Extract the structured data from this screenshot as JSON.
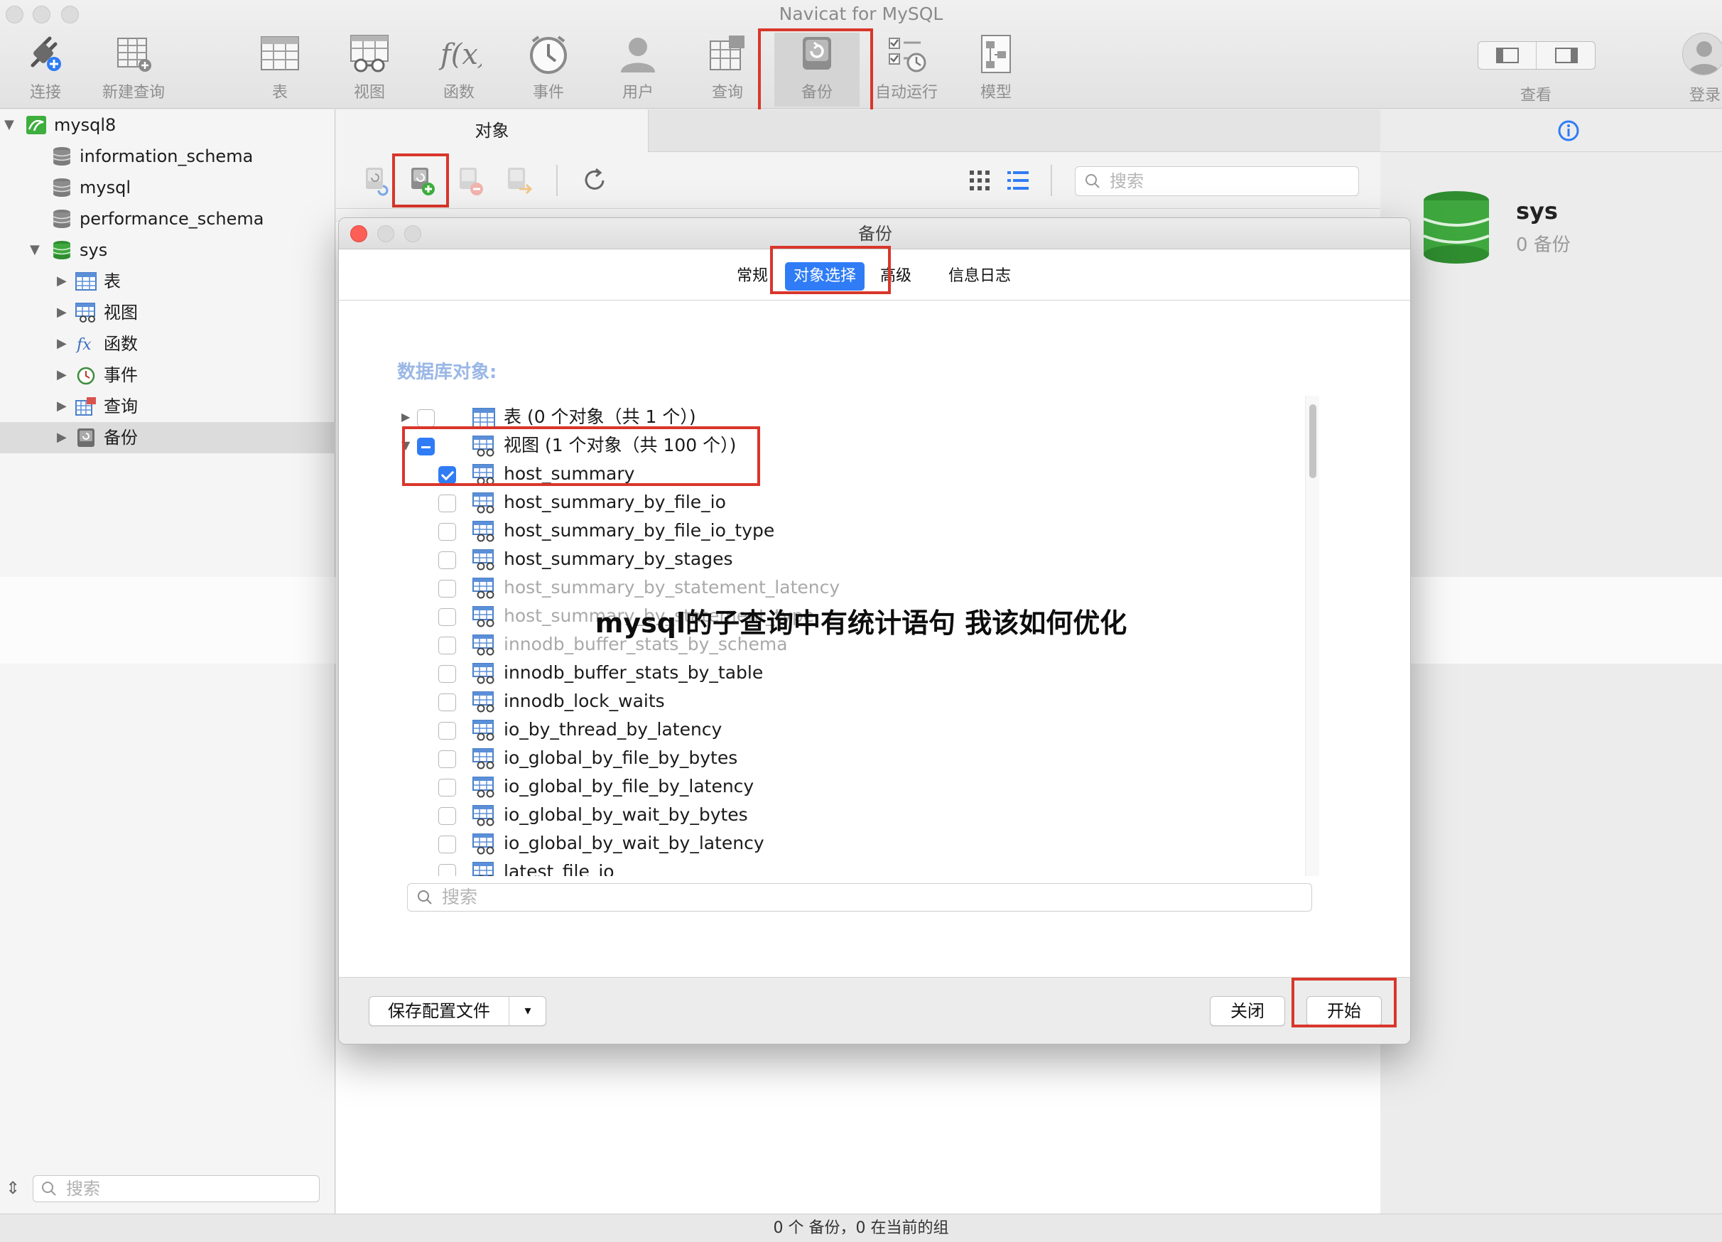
{
  "window": {
    "title": "Navicat for MySQL"
  },
  "toolbar": {
    "items": [
      {
        "label": "连接",
        "icon": "plug-icon"
      },
      {
        "label": "新建查询",
        "icon": "new-query-icon"
      },
      {
        "label": "表",
        "icon": "table-icon"
      },
      {
        "label": "视图",
        "icon": "view-icon"
      },
      {
        "label": "函数",
        "icon": "function-icon"
      },
      {
        "label": "事件",
        "icon": "clock-icon"
      },
      {
        "label": "用户",
        "icon": "user-icon"
      },
      {
        "label": "查询",
        "icon": "query-icon"
      },
      {
        "label": "备份",
        "icon": "backup-icon"
      },
      {
        "label": "自动运行",
        "icon": "checklist-clock-icon"
      },
      {
        "label": "模型",
        "icon": "model-icon"
      }
    ],
    "view_label": "查看",
    "login_label": "登录",
    "active_item": "备份"
  },
  "sidebar": {
    "connection": "mysql8",
    "databases": [
      "information_schema",
      "mysql",
      "performance_schema",
      "sys"
    ],
    "sys_children": [
      "表",
      "视图",
      "函数",
      "事件",
      "查询",
      "备份"
    ],
    "selected": "备份",
    "search_placeholder": "搜索"
  },
  "main": {
    "tab_label": "对象",
    "search_placeholder": "搜索"
  },
  "right_panel": {
    "db_name": "sys",
    "backup_count_text": "0 备份"
  },
  "dialog": {
    "title": "备份",
    "tabs": [
      "常规",
      "对象选择",
      "高级",
      "信息日志"
    ],
    "active_tab": "对象选择",
    "section_label": "数据库对象:",
    "tables_group": "表 (0 个对象（共 1 个）)",
    "views_group": "视图 (1 个对象（共 100 个）)",
    "views": [
      {
        "name": "host_summary",
        "checked": true
      },
      {
        "name": "host_summary_by_file_io",
        "checked": false
      },
      {
        "name": "host_summary_by_file_io_type",
        "checked": false
      },
      {
        "name": "host_summary_by_stages",
        "checked": false
      },
      {
        "name": "host_summary_by_statement_latency",
        "checked": false
      },
      {
        "name": "host_summary_by_statement_type",
        "checked": false
      },
      {
        "name": "innodb_buffer_stats_by_schema",
        "checked": false
      },
      {
        "name": "innodb_buffer_stats_by_table",
        "checked": false
      },
      {
        "name": "innodb_lock_waits",
        "checked": false
      },
      {
        "name": "io_by_thread_by_latency",
        "checked": false
      },
      {
        "name": "io_global_by_file_by_bytes",
        "checked": false
      },
      {
        "name": "io_global_by_file_by_latency",
        "checked": false
      },
      {
        "name": "io_global_by_wait_by_bytes",
        "checked": false
      },
      {
        "name": "io_global_by_wait_by_latency",
        "checked": false
      },
      {
        "name": "latest_file_io",
        "checked": false
      }
    ],
    "search_placeholder": "搜索",
    "save_profile_label": "保存配置文件",
    "dropdown_arrow": "▾",
    "close_label": "关闭",
    "start_label": "开始"
  },
  "status_bar": {
    "text": "0 个 备份，0 在当前的组"
  },
  "watermark": {
    "text": "mysql的子查询中有统计语句 我该如何优化"
  },
  "colors": {
    "accent": "#2f7cf6",
    "highlight_box": "#d9362b",
    "db_green": "#3a9a3a"
  }
}
